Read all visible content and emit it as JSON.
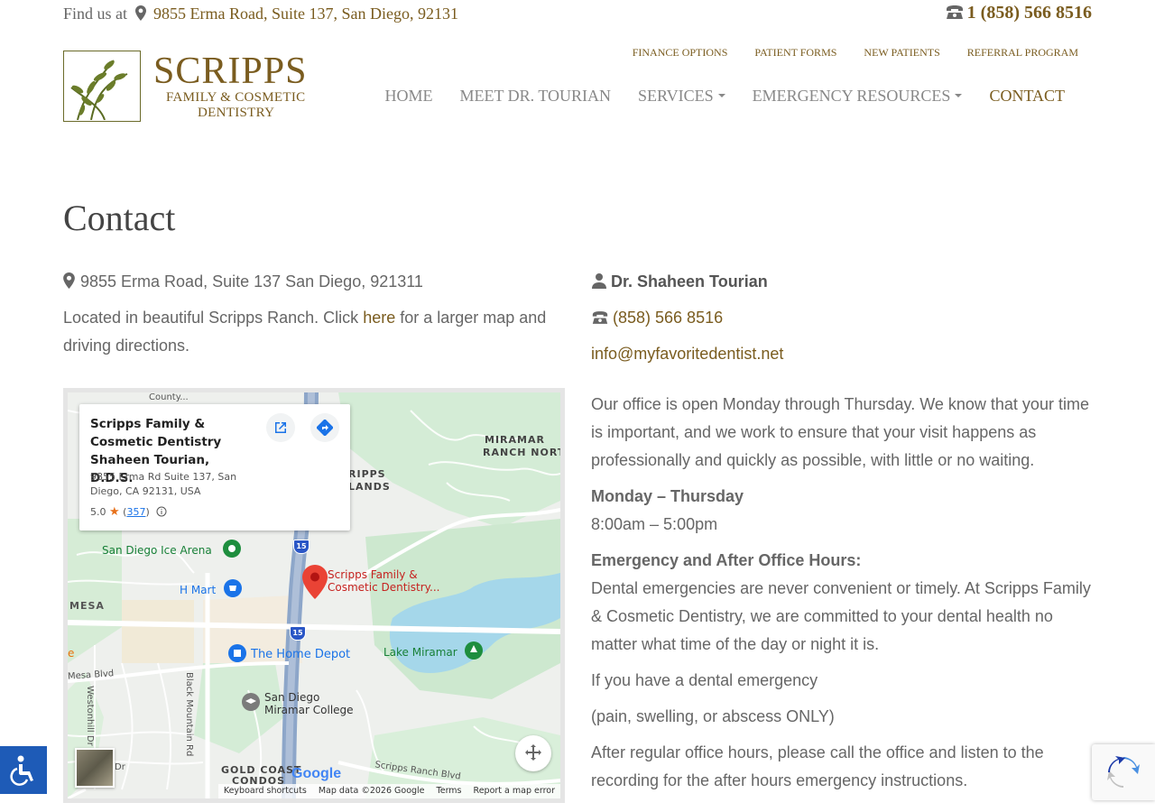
{
  "topbar": {
    "find_label": "Find us at",
    "address": "9855 Erma Road, Suite 137, San Diego, 92131",
    "phone": "1 (858) 566 8516"
  },
  "logo": {
    "brand": "SCRIPPS",
    "tagline_1": "FAMILY & COSMETIC",
    "tagline_2": "DENTISTRY"
  },
  "subnav": [
    "FINANCE OPTIONS",
    "PATIENT FORMS",
    "NEW PATIENTS",
    "REFERRAL PROGRAM"
  ],
  "mainnav": {
    "home": "HOME",
    "meet": "MEET DR. TOURIAN",
    "services": "SERVICES",
    "emergency": "EMERGENCY RESOURCES",
    "contact": "CONTACT"
  },
  "page": {
    "title": "Contact",
    "address_line": "9855 Erma Road, Suite 137 San Diego, 921311",
    "located_pre": "Located in beautiful Scripps Ranch. Click ",
    "located_link": "here",
    "located_post": " for a larger map and driving directions."
  },
  "map": {
    "card_name_1": "Scripps Family &",
    "card_name_2": "Cosmetic Dentistry",
    "card_name_3": "Shaheen Tourian, D.D.S.",
    "card_address": "9855 Erma Rd Suite 137, San Diego, CA 92131, USA",
    "rating": "5.0",
    "review_count": "357",
    "pin_label_1": "Scripps Family &",
    "pin_label_2": "Cosmetic Dentistry...",
    "labels": {
      "county": "County...",
      "miramar_1": "MIRAMAR",
      "miramar_2": "RANCH NORT",
      "scripps_1": "RIPPS",
      "scripps_2": "LANDS",
      "ice_arena": "San Diego Ice Arena",
      "hmart": "H Mart",
      "mesa": "MESA",
      "home_depot": "The Home Depot",
      "lake": "Lake Miramar",
      "college_1": "San Diego",
      "college_2": "Miramar College",
      "black_mtn": "Black Mountain Rd",
      "westonhill": "Westonhill Dr",
      "mesa_blvd": "Mesa Blvd",
      "dr": "Dr",
      "gold_coast_1": "GOLD COAST",
      "gold_coast_2": "CONDOS",
      "scripps_ranch_blvd": "Scripps Ranch Blvd",
      "hwy": "15",
      "hwy_small": "15",
      "e": "e"
    },
    "google": "Google",
    "footer": {
      "shortcuts": "Keyboard shortcuts",
      "mapdata": "Map data ©2026 Google",
      "terms": "Terms",
      "report": "Report a map error"
    }
  },
  "contact": {
    "doctor": "Dr. Shaheen Tourian",
    "phone": "(858) 566 8516",
    "email": "info@myfavoritedentist.net",
    "intro": "Our office is open Monday through Thursday. We know that your time is important, and we work to ensure that your visit happens as professionally and quickly as possible, with little or no waiting.",
    "days": "Monday – Thursday",
    "hours": "8:00am – 5:00pm",
    "emergency_heading": "Emergency and After Office Hours:",
    "emergency_text": "Dental emergencies are never convenient or timely. At Scripps Family & Cosmetic Dentistry, we are committed to your dental health no matter what time of the day or night it is.",
    "if_emergency": "If you have a dental emergency",
    "pain": "(pain, swelling, or abscess ONLY)",
    "after_hours": "After regular office hours, please call the office and listen to the recording for the after hours emergency instructions."
  },
  "colors": {
    "accent": "#7a5c1f",
    "text": "#666666",
    "access_blue": "#1e5bb7"
  }
}
